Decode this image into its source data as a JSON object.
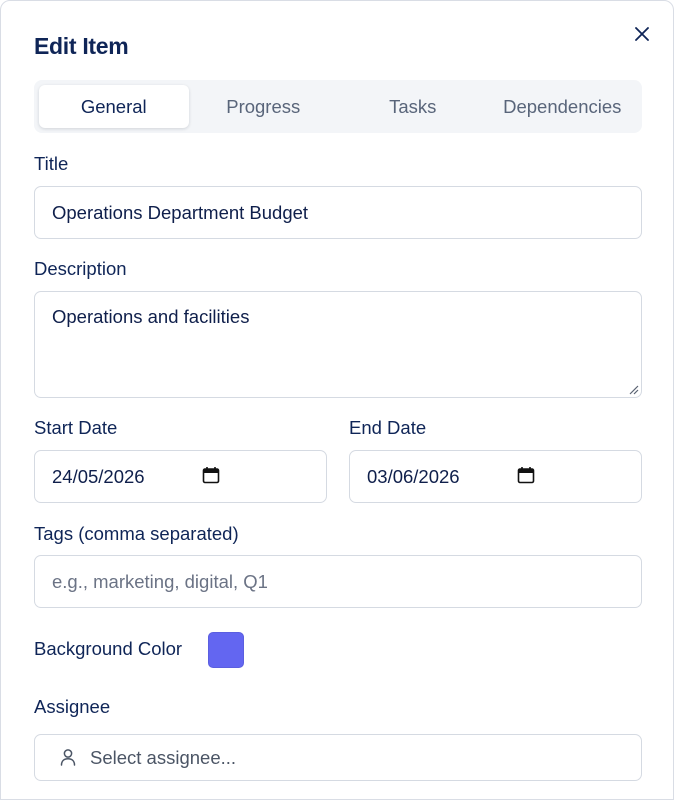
{
  "dialog": {
    "title": "Edit Item"
  },
  "tabs": [
    {
      "label": "General",
      "active": true
    },
    {
      "label": "Progress",
      "active": false
    },
    {
      "label": "Tasks",
      "active": false
    },
    {
      "label": "Dependencies",
      "active": false
    }
  ],
  "form": {
    "title": {
      "label": "Title",
      "value": "Operations Department Budget"
    },
    "description": {
      "label": "Description",
      "value": "Operations and facilities"
    },
    "start_date": {
      "label": "Start Date",
      "value": "24/05/2026"
    },
    "end_date": {
      "label": "End Date",
      "value": "03/06/2026"
    },
    "tags": {
      "label": "Tags (comma separated)",
      "value": "",
      "placeholder": "e.g., marketing, digital, Q1"
    },
    "background_color": {
      "label": "Background Color",
      "value": "#6366f1"
    },
    "assignee": {
      "label": "Assignee",
      "placeholder": "Select assignee..."
    }
  },
  "icons": {
    "close": "close-icon",
    "calendar": "calendar-icon",
    "person": "user-icon",
    "resize": "resize-handle-icon"
  },
  "colors": {
    "text": "#0f2557",
    "muted": "#59657a",
    "accent_swatch": "#6366f1"
  }
}
